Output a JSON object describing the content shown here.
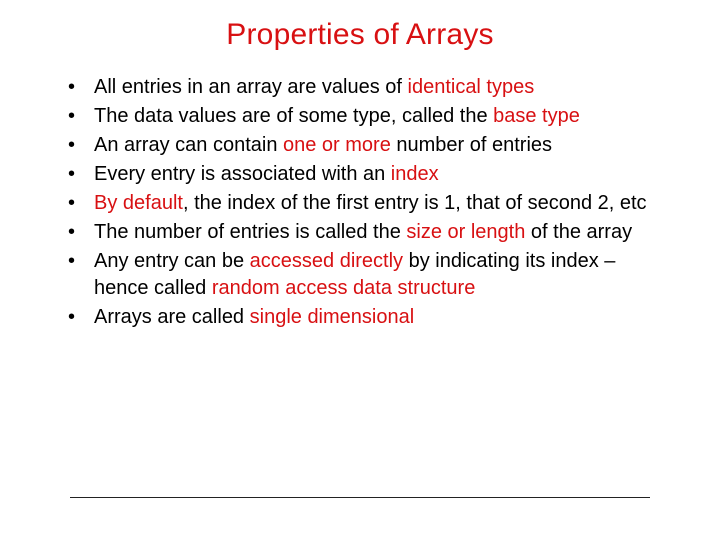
{
  "accent": "#d81012",
  "title": "Properties of Arrays",
  "bullets": [
    {
      "pre": "All entries in an array are values of ",
      "em": "identical types",
      "post": ""
    },
    {
      "pre": "The data values are of some type, called the ",
      "em": "base type",
      "post": ""
    },
    {
      "pre": "An array can contain ",
      "em": "one or more",
      "post": " number of entries"
    },
    {
      "pre": "Every entry is associated with an ",
      "em": "index",
      "post": ""
    },
    {
      "pre": "",
      "em": "By default",
      "post": ", the index of the first entry is 1, that of second 2, etc"
    },
    {
      "pre": "The number of entries is called the ",
      "em": "size or length",
      "post": " of the array"
    },
    {
      "pre": "Any entry can be ",
      "em": "accessed directly",
      "post": " by indicating its index – hence called ",
      "em2": "random access data structure"
    },
    {
      "pre": "Arrays are called  ",
      "em": "single dimensional",
      "post": ""
    }
  ]
}
